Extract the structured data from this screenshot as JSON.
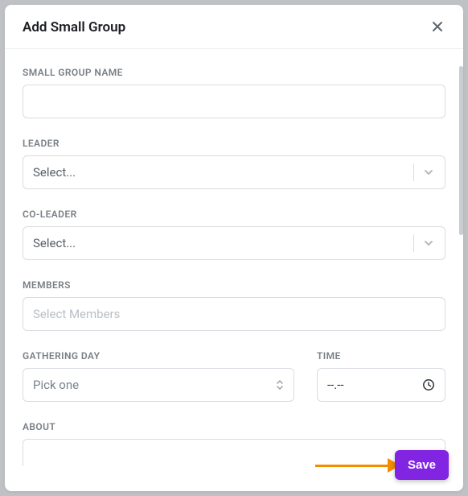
{
  "modal": {
    "title": "Add Small Group"
  },
  "fields": {
    "name": {
      "label": "SMALL GROUP NAME"
    },
    "leader": {
      "label": "LEADER",
      "placeholder": "Select..."
    },
    "coleader": {
      "label": "CO-LEADER",
      "placeholder": "Select..."
    },
    "members": {
      "label": "MEMBERS",
      "placeholder": "Select Members"
    },
    "day": {
      "label": "GATHERING DAY",
      "placeholder": "Pick one"
    },
    "time": {
      "label": "TIME",
      "value": "--.--"
    },
    "about": {
      "label": "ABOUT"
    }
  },
  "actions": {
    "save": "Save"
  }
}
